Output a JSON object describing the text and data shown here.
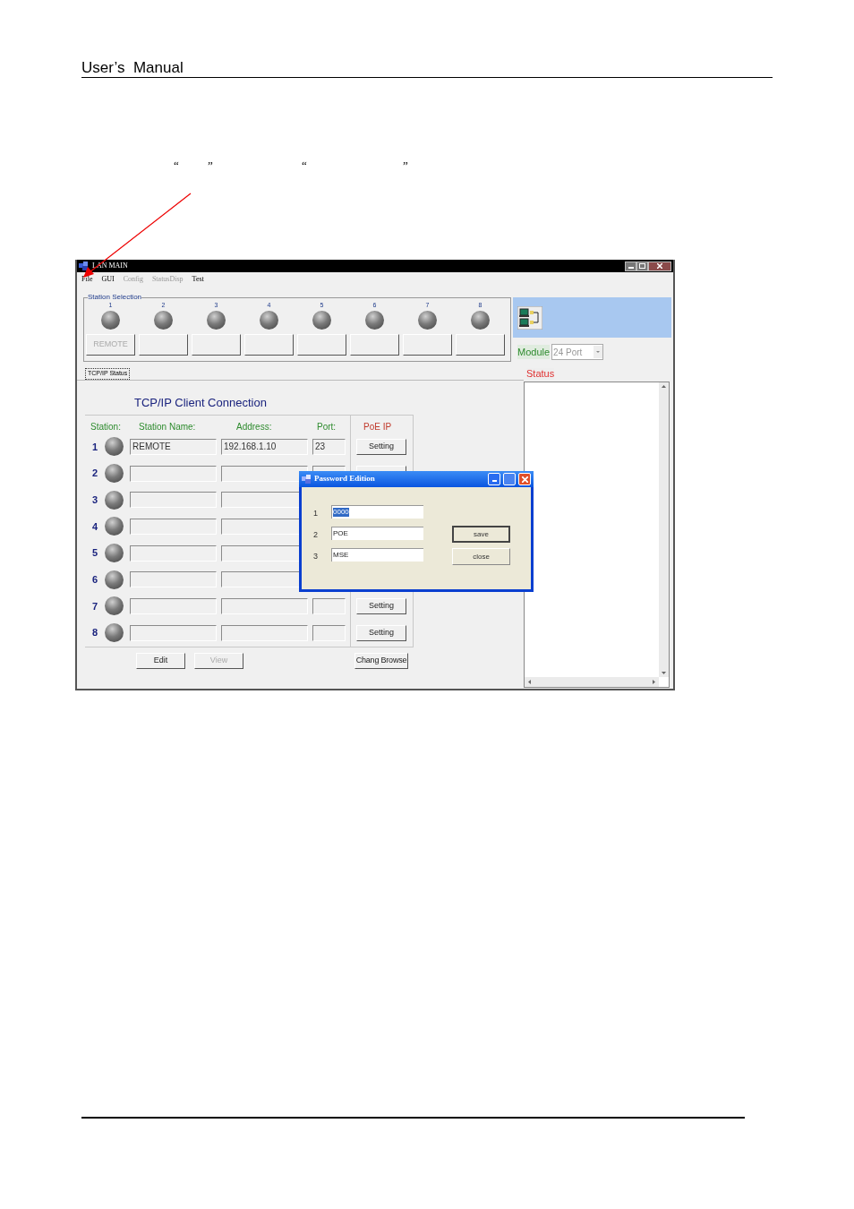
{
  "page_header": "User’s  Manual",
  "quote_marks": [
    "“",
    "”",
    "“",
    "”"
  ],
  "window": {
    "title": "LAN MAIN",
    "menu": [
      {
        "label": "File",
        "disabled": false
      },
      {
        "label": "GUI",
        "disabled": false
      },
      {
        "label": "Config",
        "disabled": true
      },
      {
        "label": "StatusDisp",
        "disabled": true
      },
      {
        "label": "Test",
        "disabled": false
      }
    ],
    "station_selection": {
      "legend": "Station Selection",
      "stations": [
        {
          "number": "1",
          "label": "REMOTE"
        },
        {
          "number": "2"
        },
        {
          "number": "3"
        },
        {
          "number": "4"
        },
        {
          "number": "5"
        },
        {
          "number": "6"
        },
        {
          "number": "7"
        },
        {
          "number": "8"
        }
      ]
    },
    "module": {
      "label": "Module",
      "value": "24 Port"
    },
    "tab": {
      "label": "TCP/IP Status",
      "selected": true
    },
    "status": {
      "label": "Status"
    },
    "connection": {
      "title": "TCP/IP Client Connection",
      "columns": [
        "Station:",
        "Station Name:",
        "Address:",
        "Port:",
        "PoE IP"
      ],
      "rows": [
        {
          "station": "1",
          "name": "REMOTE",
          "address": "192.168.1.10",
          "port": "23",
          "setting": "Setting"
        },
        {
          "station": "2"
        },
        {
          "station": "3"
        },
        {
          "station": "4"
        },
        {
          "station": "5"
        },
        {
          "station": "6"
        },
        {
          "station": "7",
          "setting": "Setting"
        },
        {
          "station": "8",
          "setting": "Setting"
        }
      ],
      "buttons": [
        {
          "label": "Edit",
          "disabled": false
        },
        {
          "label": "View",
          "disabled": true
        }
      ],
      "browse_button": "Chang Browse"
    },
    "dialog": {
      "title": "Password Edition",
      "fields": [
        {
          "number": "1",
          "value": "0000",
          "selected": true
        },
        {
          "number": "2",
          "value": "POE",
          "selected": false
        },
        {
          "number": "3",
          "value": "MSE",
          "selected": false
        }
      ],
      "buttons": [
        {
          "label": "save",
          "focused": true
        },
        {
          "label": "close",
          "focused": false
        }
      ]
    }
  }
}
